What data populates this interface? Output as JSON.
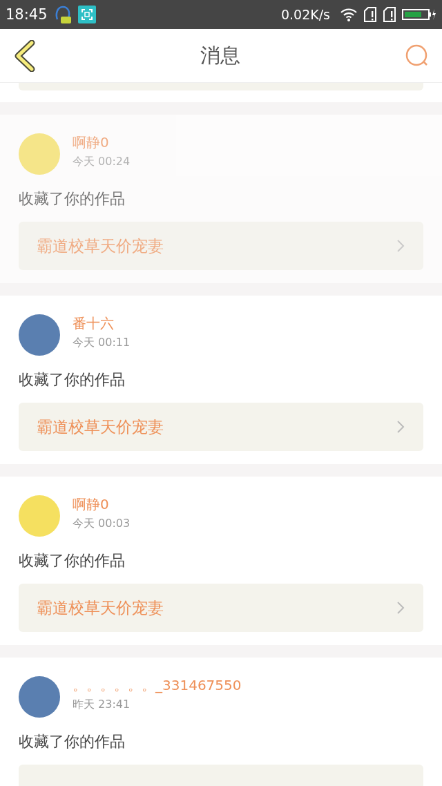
{
  "status_bar": {
    "time": "18:45",
    "speed": "0.02K/s"
  },
  "header": {
    "title": "消息"
  },
  "messages": [
    {
      "user": "啊静0",
      "time": "今天 00:24",
      "action": "收藏了你的作品",
      "work": "霸道校草天价宠妻",
      "faded": true
    },
    {
      "user": "番十六",
      "time": "今天 00:11",
      "action": "收藏了你的作品",
      "work": "霸道校草天价宠妻",
      "faded": false
    },
    {
      "user": "啊静0",
      "time": "今天 00:03",
      "action": "收藏了你的作品",
      "work": "霸道校草天价宠妻",
      "faded": false
    },
    {
      "user": "。。。。。。_331467550",
      "time": "昨天 23:41",
      "action": "收藏了你的作品",
      "faded": false
    }
  ]
}
